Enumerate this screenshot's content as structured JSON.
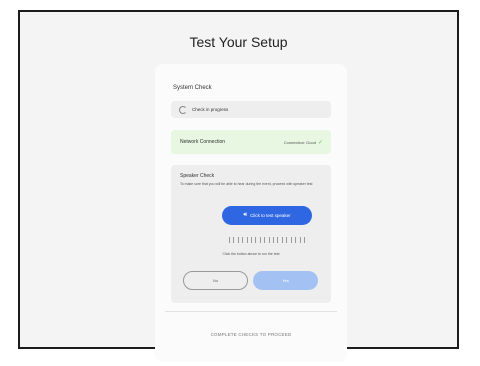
{
  "page": {
    "title": "Test Your Setup"
  },
  "system_check": {
    "label": "System Check",
    "progress_text": "Check in progress"
  },
  "network": {
    "label": "Network Connection",
    "status": "Connection: Good",
    "check_glyph": "✓"
  },
  "speaker": {
    "title": "Speaker Check",
    "description": "To make sure that you will be able to hear during the event, proceed with speaker test",
    "test_button": "Click to test speaker",
    "test_icon": "speaker-icon",
    "hint": "Click the button above to run the test",
    "no_label": "No",
    "yes_label": "Yes"
  },
  "footer": {
    "text": "COMPLETE CHECKS TO PROCEED"
  },
  "colors": {
    "accent": "#2f67e3",
    "accent_disabled": "#a3c1f2",
    "success_bg": "#e7f7e1",
    "success": "#6ac259"
  }
}
